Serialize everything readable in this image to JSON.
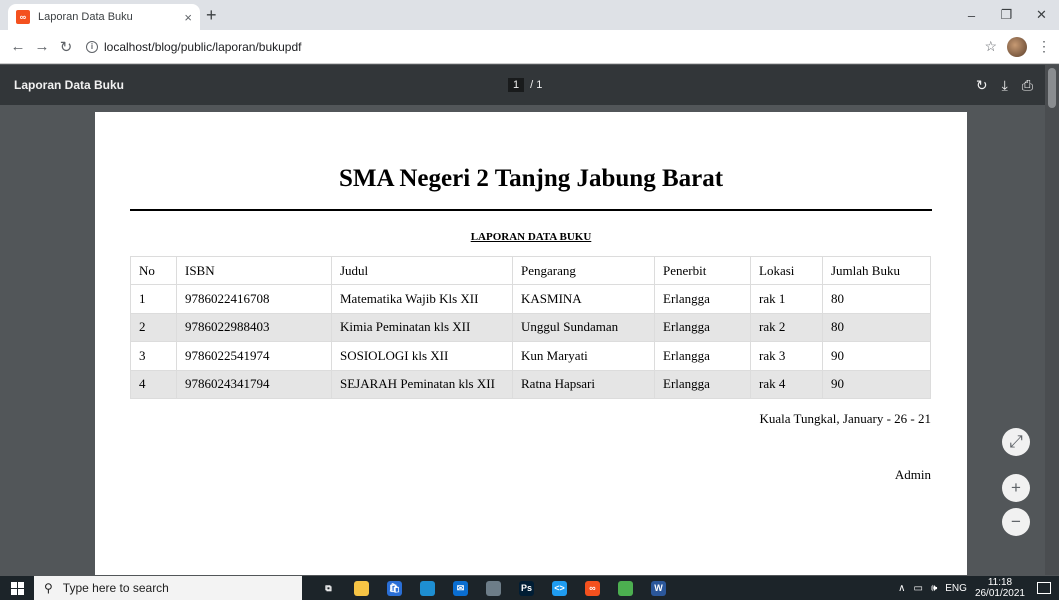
{
  "browser": {
    "tab_title": "Laporan Data Buku",
    "tab_close": "×",
    "new_tab": "+",
    "url": "localhost/blog/public/laporan/bukupdf",
    "win_min": "–",
    "win_max": "❐",
    "win_close": "✕"
  },
  "pdf_viewer": {
    "title": "Laporan Data Buku",
    "current_page": "1",
    "page_separator": "/ 1",
    "rotate_icon": "↻",
    "download_icon": "⤓",
    "print_icon": "⎙"
  },
  "document": {
    "school_name": "SMA Negeri 2 Tanjng Jabung Barat",
    "report_title": "LAPORAN DATA BUKU",
    "table": {
      "headers": [
        "No",
        "ISBN",
        "Judul",
        "Pengarang",
        "Penerbit",
        "Lokasi",
        "Jumlah Buku"
      ],
      "rows": [
        [
          "1",
          "9786022416708",
          "Matematika Wajib Kls XII",
          "KASMINA",
          "Erlangga",
          "rak 1",
          "80"
        ],
        [
          "2",
          "9786022988403",
          "Kimia Peminatan kls XII",
          "Unggul Sundaman",
          "Erlangga",
          "rak 2",
          "80"
        ],
        [
          "3",
          "9786022541974",
          "SOSIOLOGI kls XII",
          "Kun Maryati",
          "Erlangga",
          "rak 3",
          "90"
        ],
        [
          "4",
          "9786024341794",
          "SEJARAH Peminatan kls XII",
          "Ratna Hapsari",
          "Erlangga",
          "rak 4",
          "90"
        ]
      ]
    },
    "sign_date": "Kuala Tungkal, January - 26 - 21",
    "sign_name": "Admin"
  },
  "zoom": {
    "fit_icon": "⤢",
    "zoom_in": "+",
    "zoom_out": "−"
  },
  "taskbar": {
    "search_placeholder": "Type here to search",
    "tray_lang": "ENG",
    "time": "11:18",
    "date": "26/01/2021",
    "apps": [
      {
        "name": "task-view-icon",
        "color": "#1c2429",
        "glyph": "⧉"
      },
      {
        "name": "file-explorer-icon",
        "color": "#f6c445",
        "glyph": ""
      },
      {
        "name": "store-icon",
        "color": "#2a6fd6",
        "glyph": "🛍"
      },
      {
        "name": "edge-icon",
        "color": "#1e8fd2",
        "glyph": ""
      },
      {
        "name": "mail-icon",
        "color": "#0a6ed1",
        "glyph": "✉"
      },
      {
        "name": "paint-icon",
        "color": "#6d7d88",
        "glyph": ""
      },
      {
        "name": "photoshop-icon",
        "color": "#001d34",
        "glyph": "Ps"
      },
      {
        "name": "vscode-icon",
        "color": "#1f9cf0",
        "glyph": "<>"
      },
      {
        "name": "xampp-icon",
        "color": "#f4511e",
        "glyph": "∞"
      },
      {
        "name": "chrome-icon",
        "color": "#4caf50",
        "glyph": ""
      },
      {
        "name": "word-icon",
        "color": "#2b579a",
        "glyph": "W"
      }
    ]
  }
}
